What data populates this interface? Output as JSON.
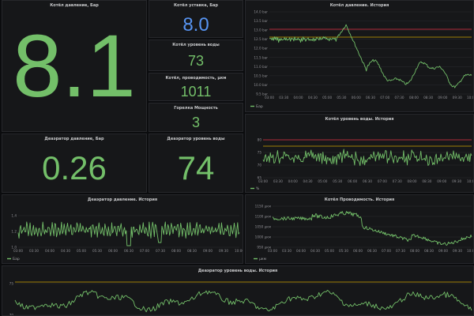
{
  "dashboard": {
    "colors": {
      "green": "#73bf69",
      "blue": "#5794f2",
      "red": "#e02f44",
      "yellow": "#cca300",
      "grid": "#2a2b2f"
    }
  },
  "stats": {
    "boiler_pressure": {
      "title": "Котёл давление, Бар",
      "value": "8.1",
      "color": "#73bf69"
    },
    "boiler_setpoint": {
      "title": "Котёл уставка, Бар",
      "value": "8.0",
      "color": "#5794f2"
    },
    "boiler_water_level": {
      "title": "Котёл уровень воды",
      "value": "73",
      "color": "#73bf69"
    },
    "boiler_conductivity": {
      "title": "Котёл, проводимость, µкм",
      "value": "1011",
      "color": "#73bf69"
    },
    "burner_power": {
      "title": "Горелка Мощность",
      "value": "3",
      "color": "#73bf69"
    },
    "deaerator_pressure": {
      "title": "Деаэратор давление, Бар",
      "value": "0.26",
      "color": "#73bf69"
    },
    "deaerator_water_level": {
      "title": "Деаэратор уровень воды",
      "value": "74",
      "color": "#73bf69"
    }
  },
  "charts": {
    "time_ticks": [
      "03:00",
      "03:30",
      "04:00",
      "04:30",
      "05:00",
      "05:30",
      "06:00",
      "06:30",
      "07:00",
      "07:30",
      "08:00",
      "08:30",
      "09:00",
      "09:30",
      "10:00"
    ],
    "boiler_pressure_history": {
      "title": "Котёл давление. История",
      "y_ticks": [
        "14.0 bar",
        "13.5 bar",
        "13.0 bar",
        "12.5 bar",
        "12.0 bar",
        "11.5 bar",
        "11.0 bar",
        "10.5 bar",
        "10.0 bar",
        "9.5 bar"
      ],
      "legend": "Бар",
      "thresholds": [
        "red",
        "yellow"
      ]
    },
    "boiler_level_history": {
      "title": "Котёл уровень воды. История",
      "y_ticks": [
        "80",
        "75",
        "70",
        "65"
      ],
      "legend": "%",
      "thresholds": [
        "red",
        "yellow"
      ]
    },
    "deaerator_pressure_history": {
      "title": "Деаэратор давление. История",
      "y_ticks": [
        "1.4",
        "1.2",
        "1.0"
      ],
      "legend": "Бар"
    },
    "boiler_conductivity_history": {
      "title": "Котёл Проводимость. История",
      "y_ticks": [
        "1150 µкм",
        "1100 µкм",
        "1050 µкм",
        "1000 µкм",
        "950 µкм"
      ],
      "legend": "µкм"
    },
    "deaerator_level_history": {
      "title": "Деаэратор уровень воды. История",
      "y_ticks": [
        "75",
        "70"
      ],
      "thresholds": [
        "yellow"
      ]
    }
  }
}
